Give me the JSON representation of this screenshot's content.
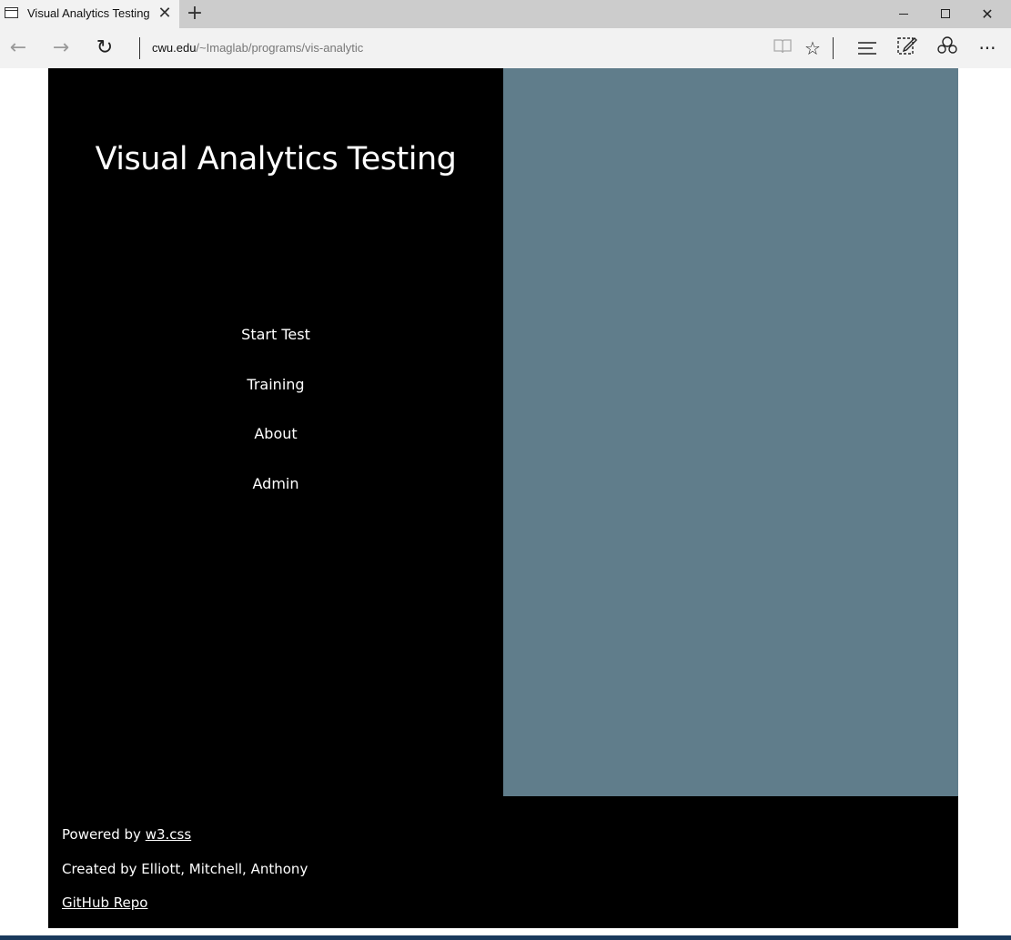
{
  "browser": {
    "tab_title": "Visual Analytics Testing",
    "tab_close": "✕",
    "new_tab": "+",
    "url_host": "cwu.edu",
    "url_path": "/~Imaglab/programs/vis-analytic",
    "icons": {
      "back": "←",
      "forward": "→",
      "refresh": "↻",
      "reading_view": "📖",
      "favorite": "☆",
      "hub": "≡",
      "web_note": "✎",
      "share": "♲",
      "more": "···",
      "close": "✕"
    }
  },
  "site": {
    "title": "Visual Analytics Testing",
    "menu": [
      {
        "label": "Start Test"
      },
      {
        "label": "Training"
      },
      {
        "label": "About"
      },
      {
        "label": "Admin"
      }
    ],
    "footer": {
      "powered_prefix": "Powered by ",
      "powered_link": "w3.css",
      "created_by": "Created by Elliott, Mitchell, Anthony",
      "repo_link": "GitHub Repo"
    },
    "colors": {
      "left_panel": "#000000",
      "right_panel": "#607d8b",
      "text": "#ffffff"
    }
  }
}
